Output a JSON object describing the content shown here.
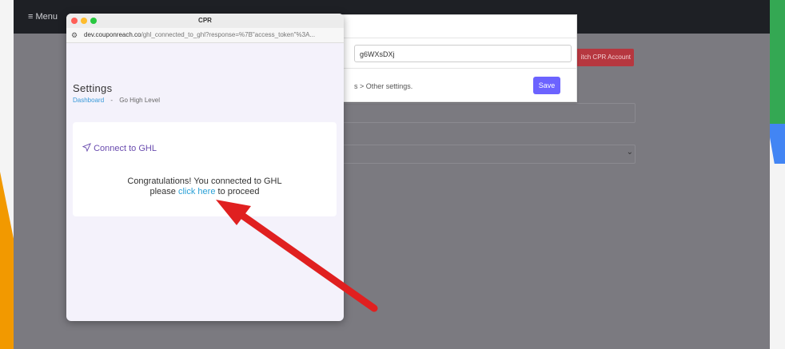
{
  "background": {
    "menu_label": "≡ Menu",
    "modal": {
      "input_value": "g6WXsDXj",
      "hint_text": "s > Other settings.",
      "save_label": "Save"
    },
    "switch_label": "itch CPR Account"
  },
  "popup": {
    "window_title": "CPR",
    "url_host": "dev.couponreach.co",
    "url_path": "/ghl_connected_to_ghl?response=%7B\"access_token\"%3A...",
    "page_title": "Settings",
    "breadcrumb": {
      "link": "Dashboard",
      "separator": "-",
      "current": "Go High Level"
    },
    "card": {
      "heading": "Connect to GHL",
      "line1": "Congratulations! You connected to GHL",
      "line2_pre": "please ",
      "line2_link": "click here",
      "line2_post": " to proceed"
    }
  },
  "colors": {
    "accent_purple": "#6c63ff",
    "link_blue": "#2aa0d6",
    "danger_red": "#b6373f",
    "annotation_arrow": "#e02020"
  }
}
